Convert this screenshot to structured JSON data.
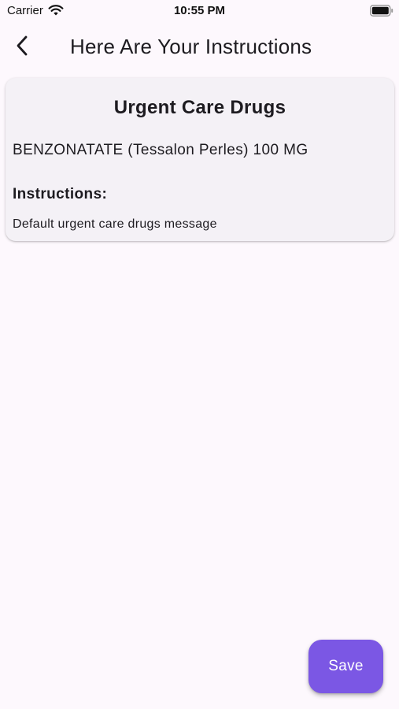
{
  "status_bar": {
    "carrier": "Carrier",
    "time": "10:55 PM",
    "icons": [
      "wifi-icon",
      "battery-icon"
    ]
  },
  "app_bar": {
    "back_icon": "chevron-left-icon",
    "title": "Here Are Your Instructions"
  },
  "card": {
    "title": "Urgent Care Drugs",
    "drug": "BENZONATATE (Tessalon Perles) 100 MG",
    "instructions_label": "Instructions:",
    "instructions_text": "Default urgent care drugs message"
  },
  "save_button": {
    "label": "Save"
  },
  "colors": {
    "background": "#fdf8fd",
    "card": "#f4f1f6",
    "accent": "#7b57e4",
    "text": "#1d1b20"
  }
}
